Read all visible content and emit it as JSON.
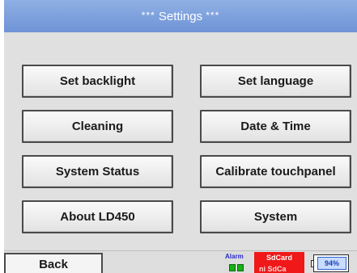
{
  "title": {
    "stars_left": "***",
    "text": "Settings",
    "stars_right": "***"
  },
  "buttons": {
    "set_backlight": "Set backlight",
    "set_language": "Set language",
    "cleaning": "Cleaning",
    "date_time": "Date & Time",
    "system_status": "System Status",
    "calibrate_touchpanel": "Calibrate touchpanel",
    "about": "About LD450",
    "system": "System"
  },
  "footer": {
    "back": "Back",
    "alarm_label": "Alarm",
    "alarm_led_color": "#18b018",
    "sdcard_label": "SdCard",
    "sdcard_sub": "ni SdCa",
    "sdcard_color": "#f01818",
    "battery_text": "94%",
    "battery_level": 0.94
  },
  "colors": {
    "title_bar": "#7a9ddc",
    "background": "#e0e0e0"
  }
}
